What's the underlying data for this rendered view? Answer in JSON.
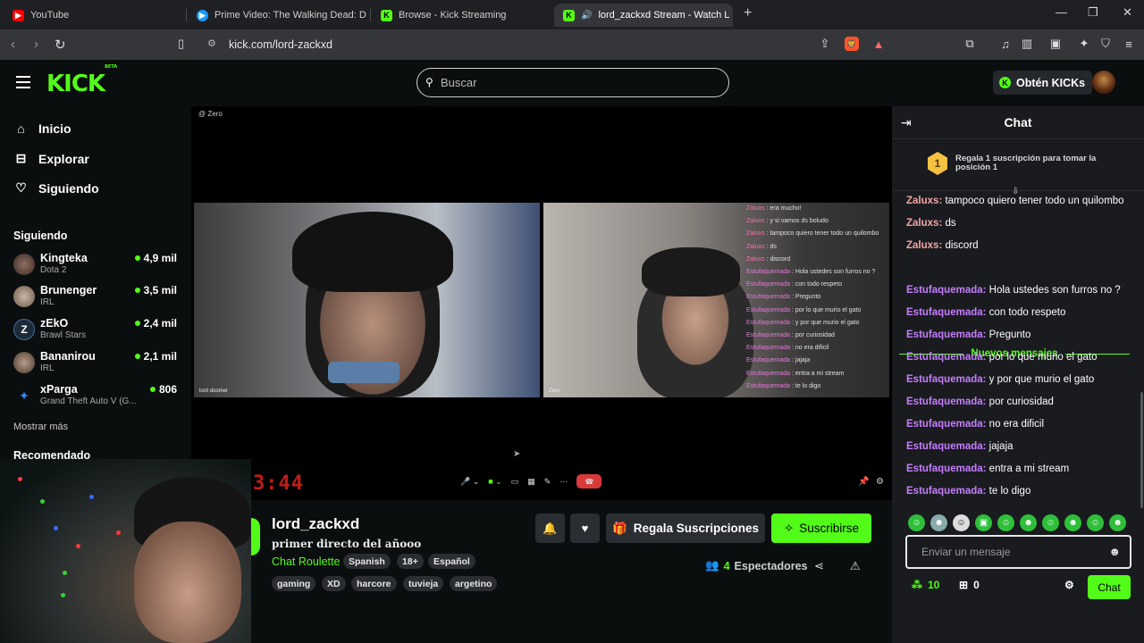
{
  "browser": {
    "tabs": [
      {
        "title": "YouTube",
        "icon": "youtube-icon"
      },
      {
        "title": "Prime Video: The Walking Dead: Dea",
        "icon": "prime-video-icon"
      },
      {
        "title": "Browse - Kick Streaming",
        "icon": "kick-icon"
      },
      {
        "title": "lord_zackxd Stream - Watch L",
        "icon": "kick-icon"
      }
    ],
    "url": "kick.com/lord-zackxd"
  },
  "header": {
    "logo": "KICK",
    "logo_badge": "BETA",
    "search_placeholder": "Buscar",
    "kicks_button": "Obtén KICKs"
  },
  "sidebar": {
    "nav": [
      {
        "label": "Inicio",
        "icon": "home-icon"
      },
      {
        "label": "Explorar",
        "icon": "explore-icon"
      },
      {
        "label": "Siguiendo",
        "icon": "heart-icon"
      }
    ],
    "following_title": "Siguiendo",
    "following": [
      {
        "name": "Kingteka",
        "category": "Dota 2",
        "viewers": "4,9 mil"
      },
      {
        "name": "Brunenger",
        "category": "IRL",
        "viewers": "3,5 mil"
      },
      {
        "name": "zEkO",
        "category": "Brawl Stars",
        "viewers": "2,4 mil"
      },
      {
        "name": "Bananirou",
        "category": "IRL",
        "viewers": "2,1 mil"
      },
      {
        "name": "xParga",
        "category": "Grand Theft Auto V (G...",
        "viewers": "806"
      }
    ],
    "show_more": "Mostrar más",
    "recommended_title": "Recomendado"
  },
  "video": {
    "top_tag": "@ Zero",
    "timer": "3:44",
    "feed1_label": "lord doomer",
    "feed2_label": "Zero",
    "overlay_chat": [
      {
        "user": "Zaluxs",
        "text": "era mucho!"
      },
      {
        "user": "Zaluxs",
        "text": "y si vamos ds boludo"
      },
      {
        "user": "Zaluxs",
        "text": "tampoco quiero tener todo un quilombo"
      },
      {
        "user": "Zaluxs",
        "text": "ds"
      },
      {
        "user": "Zaluxs",
        "text": "discord"
      },
      {
        "user": "Estufaquemada",
        "text": "Hola ustedes son furros no ?"
      },
      {
        "user": "Estufaquemada",
        "text": "con todo respeto"
      },
      {
        "user": "Estufaquemada",
        "text": "Pregunto"
      },
      {
        "user": "Estufaquemada",
        "text": "por lo que murio el gato"
      },
      {
        "user": "Estufaquemada",
        "text": "y por que murio el gato"
      },
      {
        "user": "Estufaquemada",
        "text": "por curiosidad"
      },
      {
        "user": "Estufaquemada",
        "text": "no era dificil"
      },
      {
        "user": "Estufaquemada",
        "text": "jajaja"
      },
      {
        "user": "Estufaquemada",
        "text": "entra a mi stream"
      },
      {
        "user": "Estufaquemada",
        "text": "te lo digo"
      }
    ]
  },
  "stream": {
    "channel": "lord_zackxd",
    "title": "primer directo del añooo",
    "category": "Chat Roulette",
    "tags_row1": [
      "Spanish",
      "18+",
      "Español"
    ],
    "tags_row2": [
      "gaming",
      "XD",
      "harcore",
      "tuvieja",
      "argetino"
    ],
    "gift_label": "Regala Suscripciones",
    "subscribe_label": "Suscribirse",
    "viewers_count": "4",
    "viewers_label": "Espectadores"
  },
  "chat": {
    "title": "Chat",
    "pinned_badge": "1",
    "pinned_text": "Regala 1 suscripción para tomar la posición 1",
    "new_messages": "Nuevos mensajes",
    "messages_before": [
      {
        "user": "Zaluxs",
        "text": "tampoco quiero tener todo un quilombo"
      },
      {
        "user": "Zaluxs",
        "text": "ds"
      },
      {
        "user": "Zaluxs",
        "text": "discord"
      }
    ],
    "messages_after": [
      {
        "user": "Estufaquemada",
        "text": "Hola ustedes son furros no ?"
      },
      {
        "user": "Estufaquemada",
        "text": "con todo respeto"
      },
      {
        "user": "Estufaquemada",
        "text": "Pregunto"
      },
      {
        "user": "Estufaquemada",
        "text": "por lo que murio el gato"
      },
      {
        "user": "Estufaquemada",
        "text": "y por que murio el gato"
      },
      {
        "user": "Estufaquemada",
        "text": "por curiosidad"
      },
      {
        "user": "Estufaquemada",
        "text": "no era dificil"
      },
      {
        "user": "Estufaquemada",
        "text": "jajaja"
      },
      {
        "user": "Estufaquemada",
        "text": "entra a mi stream"
      },
      {
        "user": "Estufaquemada",
        "text": "te lo digo"
      }
    ],
    "input_placeholder": "Enviar un mensaje",
    "points": "10",
    "gifts": "0",
    "send_label": "Chat"
  },
  "colors": {
    "accent": "#53fc18",
    "user_zaluxs": "#f4a6a6",
    "user_estufa": "#c67dff"
  }
}
